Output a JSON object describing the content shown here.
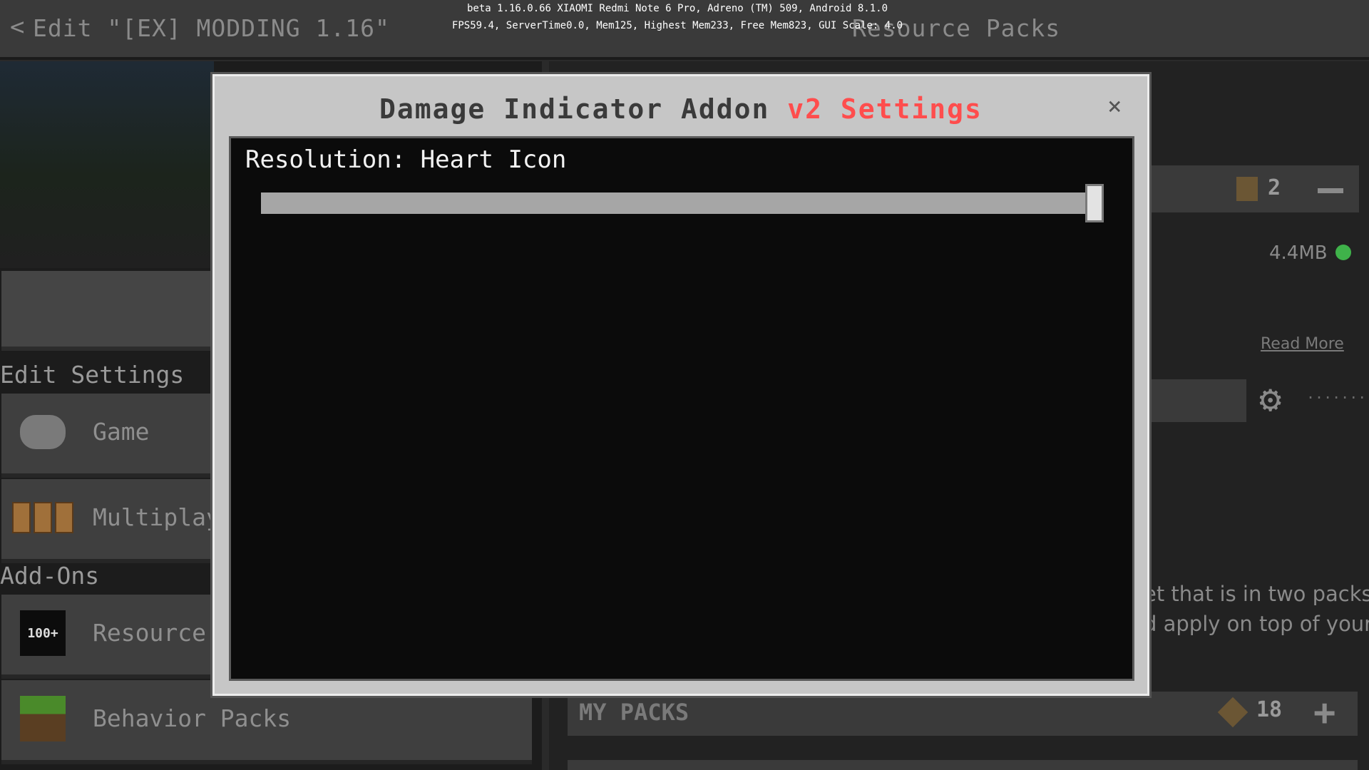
{
  "header": {
    "back_glyph": "<",
    "left_title": "Edit \"[EX] MODDING 1.16\"",
    "right_title": "Resource Packs",
    "debug_line1": "beta 1.16.0.66 XIAOMI Redmi Note 6 Pro, Adreno (TM) 509, Android 8.1.0",
    "debug_line2": "FPS59.4, ServerTime0.0, Mem125, Highest Mem233, Free Mem823, GUI Scale: 4.0"
  },
  "sidebar": {
    "edit_settings_heading": "Edit Settings",
    "addons_heading": "Add-Ons",
    "items": [
      {
        "label": "Game",
        "icon": "controller-icon"
      },
      {
        "label": "Multiplayer",
        "icon": "players-icon"
      },
      {
        "label": "Resource Packs",
        "icon": "resource-badge-icon",
        "badge": "100+"
      },
      {
        "label": "Behavior Packs",
        "icon": "grass-block-icon"
      }
    ]
  },
  "right_panel": {
    "active_count": "2",
    "pack_size": "4.4MB",
    "read_more": "Read More",
    "warning_line1": "et that is in two packs",
    "warning_line2": "d apply on top of your",
    "my_packs_label": "MY PACKS",
    "my_packs_count": "18",
    "status_color": "#3fb24a"
  },
  "modal": {
    "title_main": "Damage Indicator Addon",
    "title_highlight": "v2 Settings",
    "highlight_color": "#ff4d4d",
    "close_glyph": "×",
    "setting_label": "Resolution: Heart Icon",
    "slider_value_fraction": 1.0
  }
}
